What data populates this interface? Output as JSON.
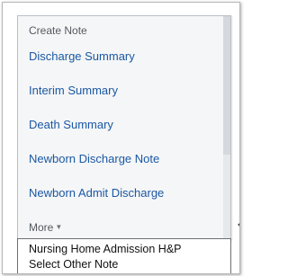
{
  "menu": {
    "header": "Create Note",
    "items": [
      {
        "label": "Discharge Summary"
      },
      {
        "label": "Interim Summary"
      },
      {
        "label": "Death Summary"
      },
      {
        "label": "Newborn Discharge Note"
      },
      {
        "label": "Newborn Admit Discharge"
      }
    ],
    "more_label": "More",
    "more_icon": "caret-down-icon",
    "expand_icon": "chevron-down-icon"
  },
  "dropdown": {
    "items": [
      {
        "label": "Nursing Home Admission H&P"
      },
      {
        "label": "Select Other Note"
      }
    ]
  },
  "colors": {
    "link": "#1a58a3",
    "header_text": "#555a60",
    "panel_bg": "#f5f6f7"
  }
}
